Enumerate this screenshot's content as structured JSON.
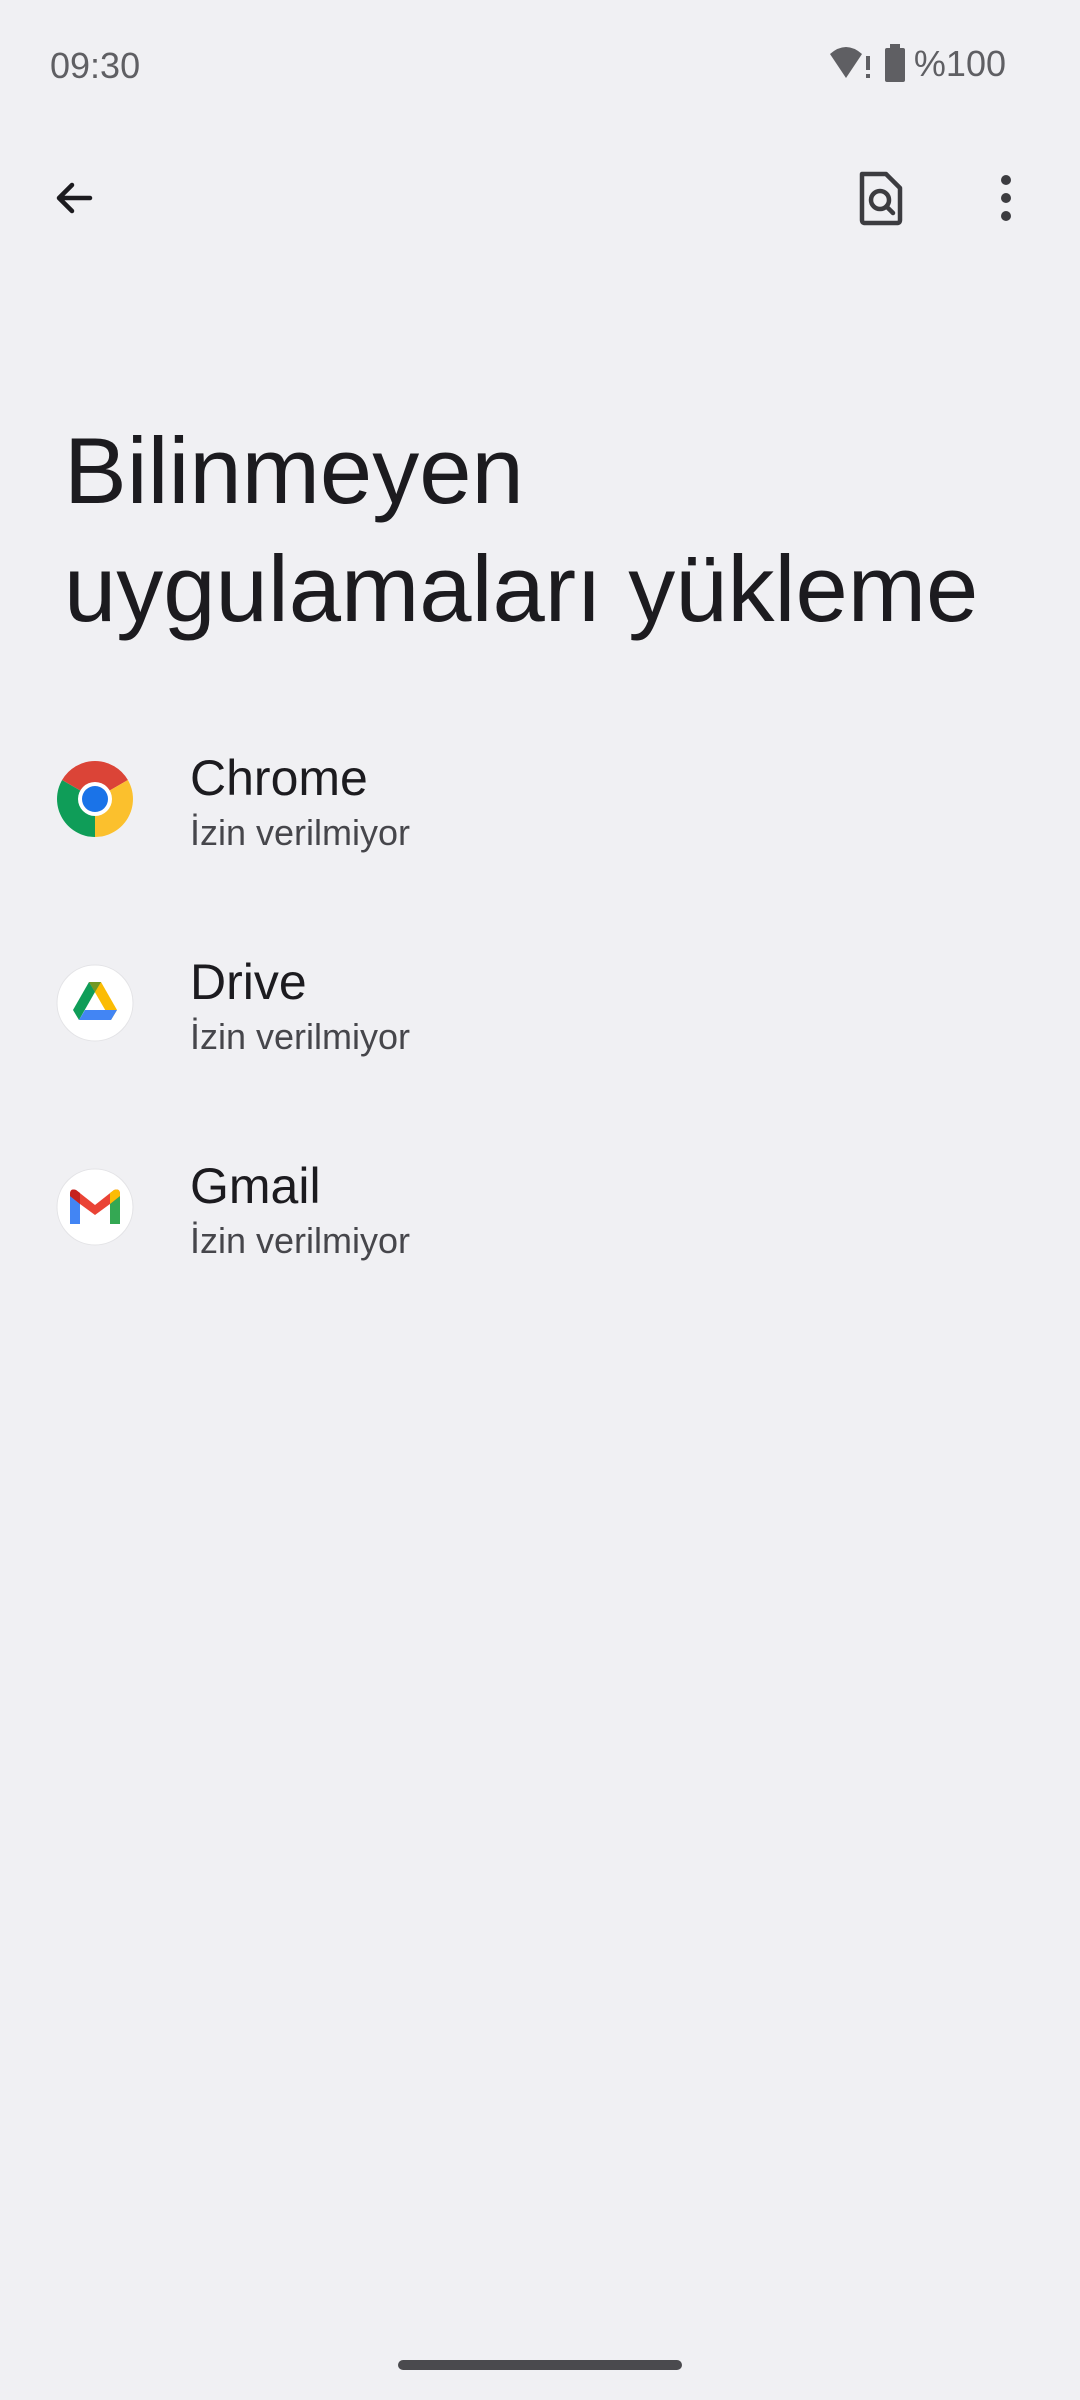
{
  "status_bar": {
    "time": "09:30",
    "battery": "%100",
    "icons": [
      "wifi-alert-icon",
      "battery-icon"
    ]
  },
  "app_bar": {
    "back_icon": "arrow-back-icon",
    "search_icon": "search-page-icon",
    "more_icon": "more-vert-icon"
  },
  "page": {
    "title": "Bilinmeyen uygulamaları yükleme"
  },
  "apps": [
    {
      "name": "Chrome",
      "status": "İzin verilmiyor",
      "icon": "chrome-icon"
    },
    {
      "name": "Drive",
      "status": "İzin verilmiyor",
      "icon": "drive-icon"
    },
    {
      "name": "Gmail",
      "status": "İzin verilmiyor",
      "icon": "gmail-icon"
    }
  ],
  "colors": {
    "background": "#f0f0f3",
    "text_primary": "#1c1b1f",
    "text_secondary": "#46464b"
  }
}
